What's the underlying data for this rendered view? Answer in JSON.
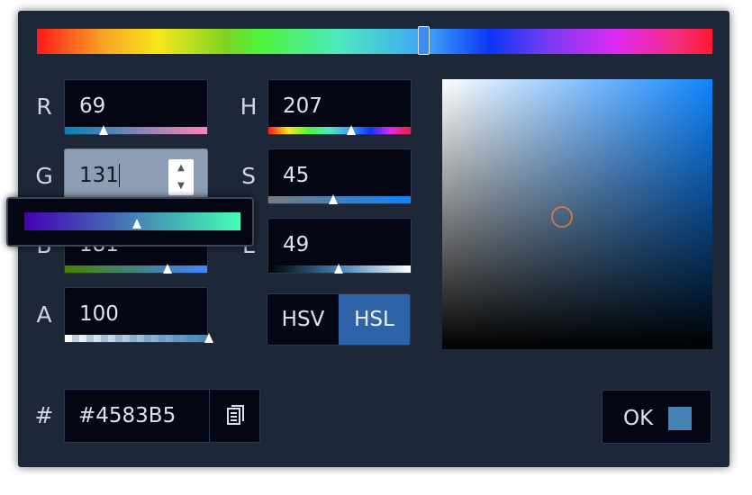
{
  "colors": {
    "accent": "#2e64a7",
    "current_color": "#4583B5",
    "panel_bg": "#1e2738",
    "field_bg": "#040713"
  },
  "channels": {
    "r": {
      "label": "R",
      "value": "69"
    },
    "g": {
      "label": "G",
      "value": "131"
    },
    "b": {
      "label": "B",
      "value": "181"
    },
    "a": {
      "label": "A",
      "value": "100"
    },
    "h": {
      "label": "H",
      "value": "207"
    },
    "s": {
      "label": "S",
      "value": "45"
    },
    "l": {
      "label": "L",
      "value": "49"
    }
  },
  "slider_levels": {
    "hue_fraction": 0.575,
    "r_fraction": 0.27,
    "g_fraction": 0.51,
    "b_fraction": 0.71,
    "a_fraction": 1.0,
    "h_fraction": 0.575,
    "s_fraction": 0.45,
    "l_fraction": 0.49
  },
  "mode_toggle": {
    "options": [
      "HSV",
      "HSL"
    ],
    "selected": "HSL"
  },
  "hex": {
    "label": "#",
    "value": "#4583B5"
  },
  "buttons": {
    "ok_label": "OK"
  },
  "icons": {
    "copy": "clipboard-copy-icon",
    "spin_up": "caret-up-icon",
    "spin_down": "caret-down-icon"
  }
}
